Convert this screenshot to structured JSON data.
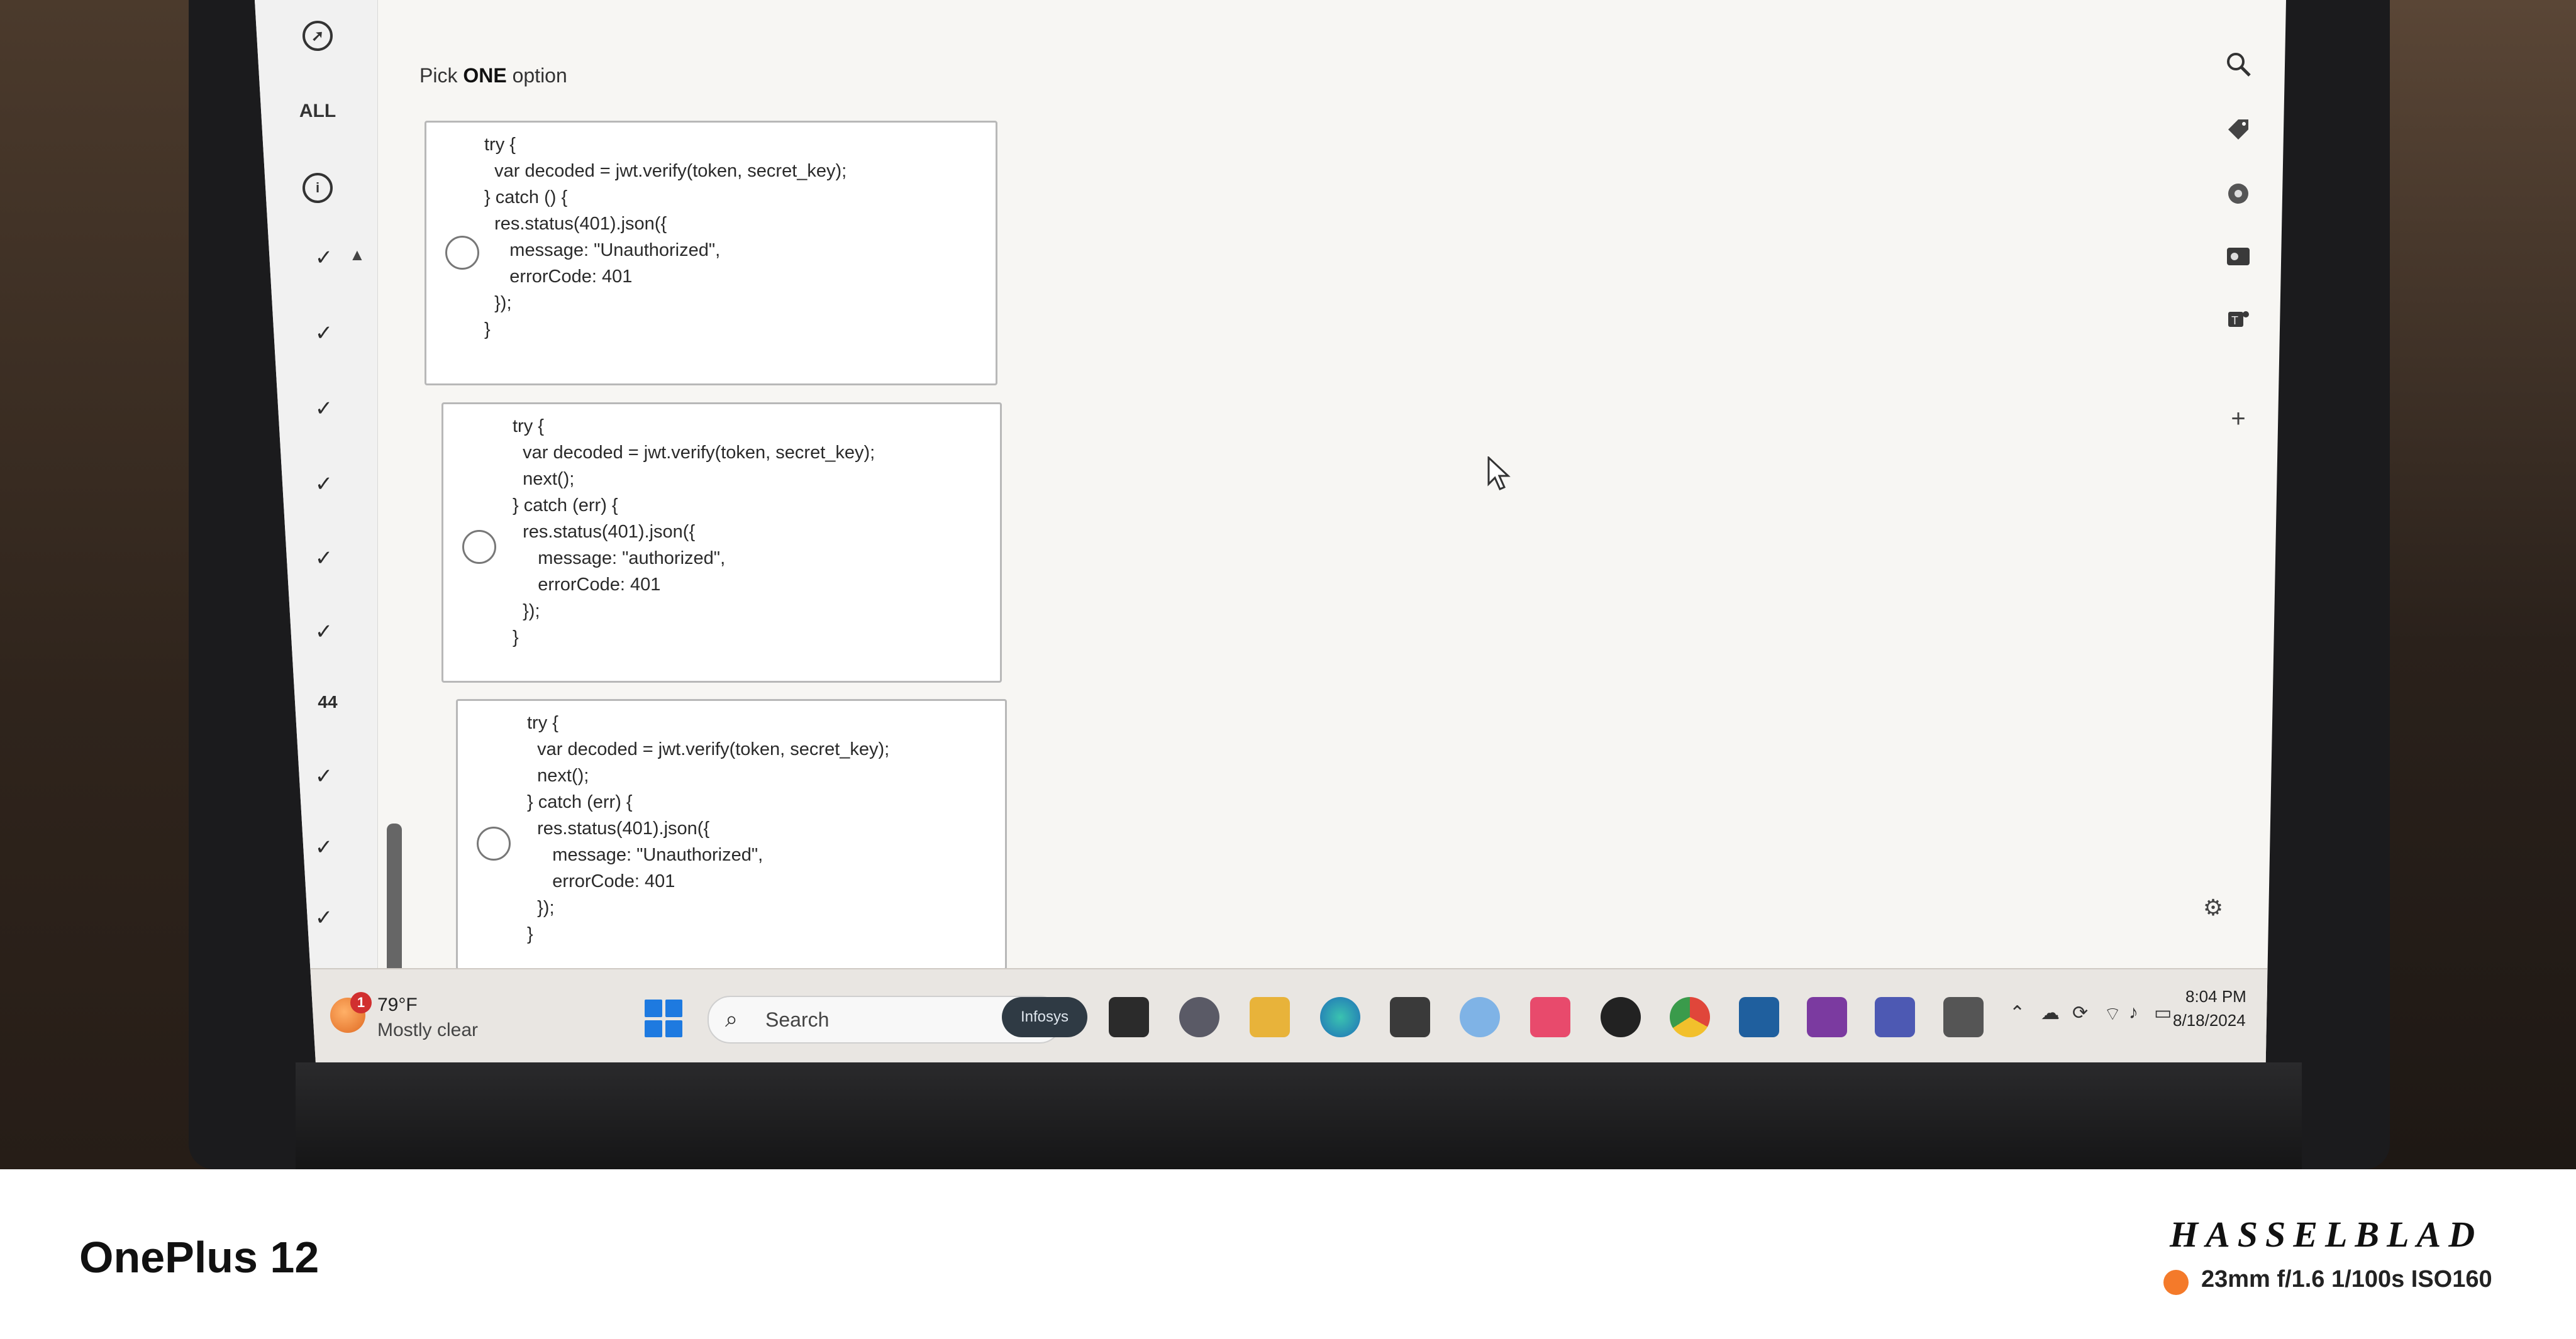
{
  "left_rail": {
    "all_label": "ALL",
    "current_question": "44"
  },
  "content": {
    "prompt_prefix": "Pick ",
    "prompt_emphasis": "ONE",
    "prompt_suffix": " option",
    "options": [
      {
        "code": "try {\n  var decoded = jwt.verify(token, secret_key);\n} catch () {\n  res.status(401).json({\n     message: \"Unauthorized\",\n     errorCode: 401\n  });\n}"
      },
      {
        "code": "try {\n  var decoded = jwt.verify(token, secret_key);\n  next();\n} catch (err) {\n  res.status(401).json({\n     message: \"authorized\",\n     errorCode: 401\n  });\n}"
      },
      {
        "code": "try {\n  var decoded = jwt.verify(token, secret_key);\n  next();\n} catch (err) {\n  res.status(401).json({\n     message: \"Unauthorized\",\n     errorCode: 401\n  });\n}"
      }
    ]
  },
  "taskbar": {
    "temperature": "79°F",
    "weather_desc": "Mostly clear",
    "weather_badge": "1",
    "search_label": "Search",
    "infosys_label": "Infosys",
    "clock_time": "8:04 PM",
    "clock_date": "8/18/2024"
  },
  "photo_watermark": {
    "device": "OnePlus 12",
    "brand": "HASSELBLAD",
    "camera_settings": "23mm  f/1.6  1/100s  ISO160",
    "accent_color": "#f47a2a"
  }
}
